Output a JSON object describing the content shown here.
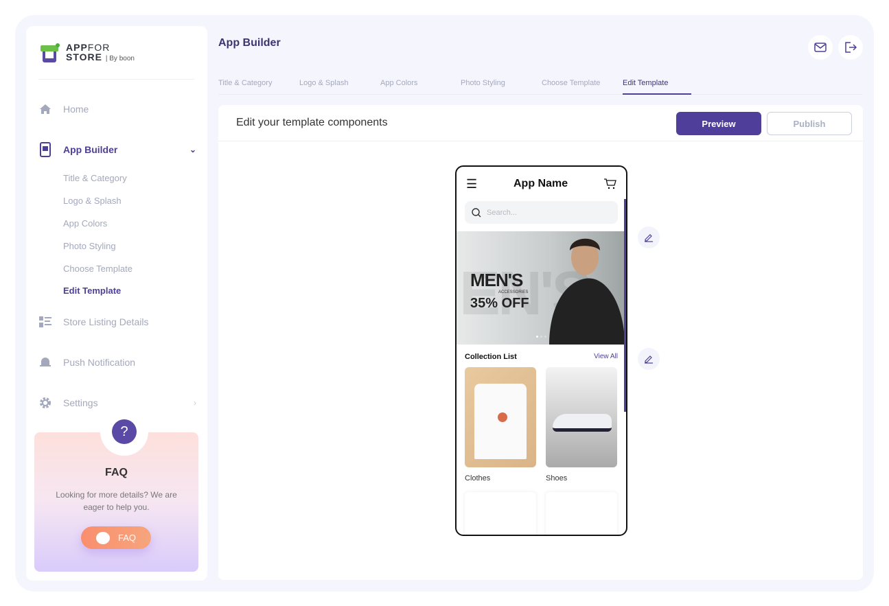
{
  "brand": {
    "line1_bold": "APP",
    "line1": "FOR",
    "line2": "STORE",
    "by": "By boon"
  },
  "sidebar": {
    "items": [
      {
        "label": "Home",
        "icon": "home-icon"
      },
      {
        "label": "App Builder",
        "icon": "app-builder-icon"
      },
      {
        "label": "Store Listing Details",
        "icon": "list-icon"
      },
      {
        "label": "Push Notification",
        "icon": "bell-icon"
      },
      {
        "label": "Settings",
        "icon": "gear-icon"
      }
    ],
    "subitems": [
      "Title & Category",
      "Logo & Splash",
      "App Colors",
      "Photo Styling",
      "Choose Template",
      "Edit Template"
    ]
  },
  "faq": {
    "title": "FAQ",
    "text": "Looking for more details? We are eager to help you.",
    "button": "FAQ"
  },
  "header": {
    "title": "App Builder"
  },
  "tabs": [
    "Title & Category",
    "Logo & Splash",
    "App Colors",
    "Photo Styling",
    "Choose Template",
    "Edit Template"
  ],
  "main": {
    "heading": "Edit your template components",
    "preview": "Preview",
    "publish": "Publish"
  },
  "phone": {
    "app_name": "App Name",
    "search_placeholder": "Search...",
    "banner_title": "MEN'S",
    "banner_sub": "ACCESSORIES",
    "banner_offer": "35% OFF",
    "banner_bg": "EN'S",
    "collection_title": "Collection List",
    "view_all": "View All",
    "collections": [
      "Clothes",
      "Shoes"
    ]
  },
  "colors": {
    "accent": "#4f3f9a",
    "faq_button": "#f98e6e"
  }
}
